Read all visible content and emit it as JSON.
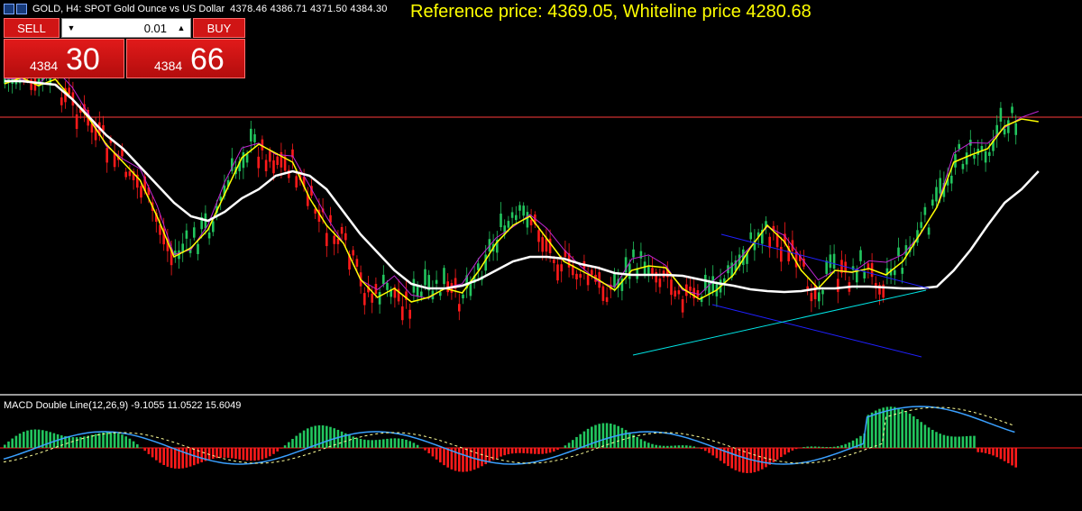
{
  "header": {
    "symbol_title": "GOLD, H4:  SPOT Gold Ounce vs US Dollar",
    "ohlc": "4378.46 4386.71 4371.50 4384.30",
    "reference_text": "Reference price: 4369.05, Whiteline price 4280.68"
  },
  "trade_panel": {
    "sell_label": "SELL",
    "buy_label": "BUY",
    "lot_value": "0.01",
    "sell_price_small": "4384",
    "sell_price_big": "30",
    "buy_price_small": "4384",
    "buy_price_big": "66"
  },
  "indicator": {
    "label": "MACD Double Line(12,26,9) -9.1055 11.0522 15.6049"
  },
  "colors": {
    "bull": "#22c55e",
    "bear": "#ff1a1a",
    "ma_yellow": "#ffff00",
    "ma_white": "#ffffff",
    "ma_purple": "#c026d3",
    "channel_blue": "#2020ff",
    "trend_cyan": "#00e5e5",
    "price_line": "#ff3b3b",
    "macd_blue": "#3aa0ff",
    "macd_magenta": "#ff00ff",
    "separator": "#9a9a9a"
  },
  "chart_data": {
    "type": "line",
    "series": [
      {
        "values": [
          93,
          86,
          95,
          88,
          110,
          132,
          160,
          180,
          200,
          240,
          285,
          275,
          255,
          215,
          175,
          160,
          170,
          180,
          220,
          250,
          270,
          310,
          330,
          320,
          335,
          330,
          320,
          325,
          300,
          270,
          250,
          240,
          265,
          290,
          300,
          310,
          322,
          300,
          295,
          297,
          320,
          332,
          322,
          305,
          275,
          250,
          268,
          300,
          320,
          300,
          302,
          298,
          305,
          290,
          260,
          230,
          180,
          172,
          165,
          140,
          132,
          135
        ]
      },
      {
        "values": [
          90,
          90,
          92,
          94,
          110,
          130,
          150,
          165,
          185,
          205,
          225,
          240,
          245,
          235,
          220,
          210,
          195,
          190,
          195,
          210,
          235,
          260,
          280,
          300,
          315,
          320,
          320,
          317,
          310,
          300,
          290,
          285,
          285,
          287,
          293,
          297,
          303,
          305,
          305,
          305,
          306,
          310,
          314,
          317,
          321,
          323,
          324,
          323,
          320,
          320,
          318,
          318,
          319,
          320,
          320,
          318,
          300,
          277,
          250,
          225,
          210,
          190
        ]
      }
    ]
  }
}
